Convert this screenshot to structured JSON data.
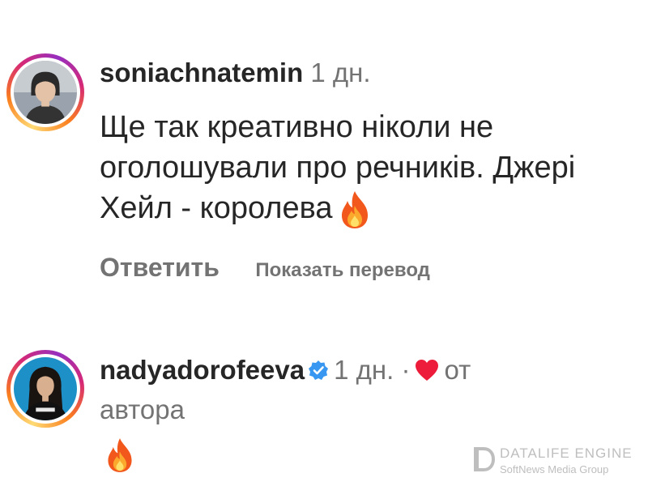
{
  "comments": [
    {
      "username": "soniachnatemin",
      "time": "1 дн.",
      "text": "Ще так креативно ніколи не оголошували про речників. Джері Хейл - королева",
      "emoji_icon": "fire-icon",
      "reply_label": "Ответить",
      "translate_label": "Показать перевод",
      "avatar_ring_colors": [
        "#feda75",
        "#fa7e1e",
        "#d62976",
        "#962fbf"
      ]
    },
    {
      "username": "nadyadorofeeva",
      "verified": true,
      "verified_icon": "verified-badge-icon",
      "time": "1 дн.",
      "separator": "·",
      "liked_icon": "heart-icon",
      "author_like_label_1": "от",
      "author_like_label_2": "автора",
      "emoji_icon": "fire-icon"
    }
  ],
  "watermark": {
    "title": "DATALIFE ENGINE",
    "subtitle": "SoftNews Media Group",
    "logo_icon": "datalife-logo-icon"
  },
  "colors": {
    "text_primary": "#262626",
    "text_secondary": "#737373",
    "heart": "#ed1c3a",
    "verified": "#3897f0"
  }
}
